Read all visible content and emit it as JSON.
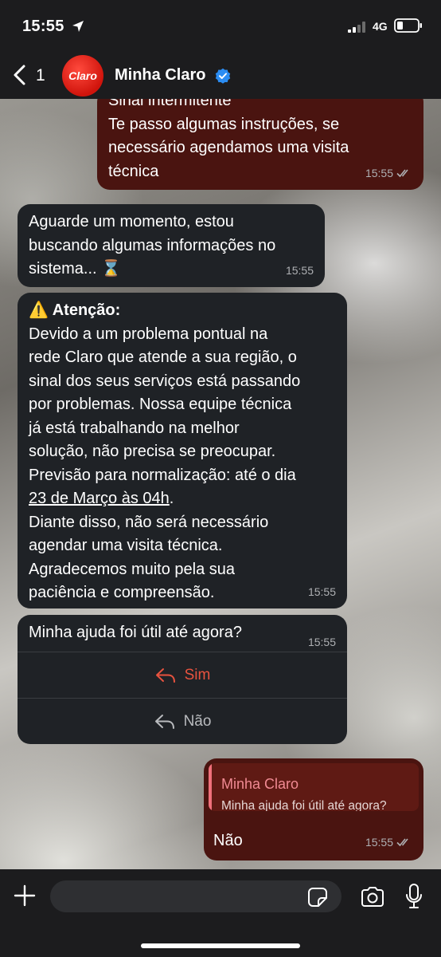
{
  "status_bar": {
    "time": "15:55",
    "network": "4G",
    "location_icon": "location-arrow-icon",
    "signal_icon": "signal-bars-icon",
    "battery_icon": "battery-low-icon"
  },
  "header": {
    "back_count": "1",
    "avatar_text": "Claro",
    "contact_name": "Minha Claro",
    "verified_icon": "verified-badge-icon",
    "brand_color": "#da291c"
  },
  "messages": [
    {
      "direction": "outgoing",
      "text": "Sinal intermitente\nTe passo algumas instruções, se\nnecessário agendamos uma visita\ntécnica",
      "time": "15:55",
      "status": "read"
    },
    {
      "direction": "incoming",
      "text": "Aguarde um momento, estou\nbuscando algumas informações no\nsistema... ⌛",
      "time": "15:55"
    },
    {
      "direction": "incoming",
      "title": "⚠️ Atenção:",
      "text_before_link": "Devido a um problema pontual na\nrede Claro que atende a sua região, o\nsinal dos seus serviços está passando\npor problemas. Nossa equipe técnica\njá está trabalhando na melhor\nsolução, não precisa se preocupar.\nPrevisão para normalização: até o dia\n",
      "link_text": "23 de Março às 04h",
      "text_after_link": ".\nDiante disso, não será necessário\nagendar uma visita técnica.\nAgradecemos muito pela sua\npaciência e compreensão.",
      "time": "15:55"
    },
    {
      "direction": "incoming",
      "text": "Minha ajuda foi útil até agora?",
      "time": "15:55",
      "quick_replies": [
        {
          "label": "Sim",
          "icon": "reply-arrow-icon",
          "color": "#e8533f"
        },
        {
          "label": "Não",
          "icon": "reply-arrow-icon",
          "color": "#b9bbbe"
        }
      ]
    },
    {
      "direction": "outgoing",
      "quoted_author": "Minha Claro",
      "quoted_text": "Minha ajuda foi útil até agora?",
      "text": "Não",
      "time": "15:55",
      "status": "read"
    }
  ],
  "composer": {
    "input_value": "",
    "input_placeholder": "",
    "icons": [
      "plus-icon",
      "sticker-icon",
      "camera-icon",
      "microphone-icon"
    ]
  },
  "colors": {
    "outgoing_bubble": "#4a1410",
    "incoming_bubble": "#1f2226",
    "accent": "#e8533f",
    "read_ticks": "#aeb0b3"
  }
}
